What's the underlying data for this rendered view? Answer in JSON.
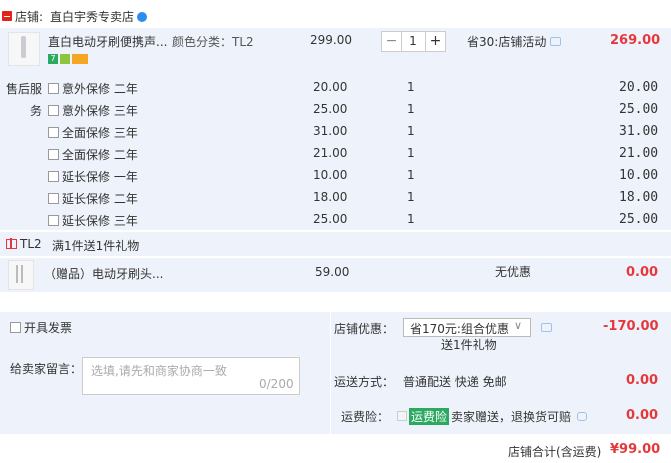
{
  "shop": {
    "label": "店铺:",
    "name": "直白宇秀专卖店"
  },
  "product": {
    "title": "直白电动牙刷便携声...",
    "variant": "颜色分类：TL2",
    "price": "299.00",
    "quantity": "1",
    "promo": "省30:店铺活动",
    "subtotal": "269.00",
    "minus": "−",
    "plus": "+"
  },
  "service": {
    "label_line1": "售后服",
    "label_line2": "务",
    "items": [
      {
        "name": "意外保修 二年",
        "price": "20.00",
        "qty": "1",
        "subtotal": "20.00"
      },
      {
        "name": "意外保修 三年",
        "price": "25.00",
        "qty": "1",
        "subtotal": "25.00"
      },
      {
        "name": "全面保修 三年",
        "price": "31.00",
        "qty": "1",
        "subtotal": "31.00"
      },
      {
        "name": "全面保修 二年",
        "price": "21.00",
        "qty": "1",
        "subtotal": "21.00"
      },
      {
        "name": "延长保修 一年",
        "price": "10.00",
        "qty": "1",
        "subtotal": "10.00"
      },
      {
        "name": "延长保修 二年",
        "price": "18.00",
        "qty": "1",
        "subtotal": "18.00"
      },
      {
        "name": "延长保修 三年",
        "price": "25.00",
        "qty": "1",
        "subtotal": "25.00"
      }
    ]
  },
  "gift_group": {
    "tag": "TL2",
    "rule": "满1件送1件礼物"
  },
  "gift": {
    "title": "（赠品）电动牙刷头...",
    "price": "59.00",
    "discount": "无优惠",
    "subtotal": "0.00"
  },
  "invoice": {
    "label": "开具发票"
  },
  "message": {
    "label": "给卖家留言：",
    "placeholder": "选填,请先和商家协商一致",
    "counter": "0/200"
  },
  "shop_discount": {
    "label": "店铺优惠：",
    "selected": "省170元:组合优惠",
    "note": "送1件礼物",
    "amount": "-170.00"
  },
  "shipping": {
    "label": "运送方式：",
    "value": "普通配送 快递 免邮",
    "amount": "0.00"
  },
  "insurance": {
    "label": "运费险：",
    "badge": "运费险",
    "text": "卖家赠送，退换货可赔",
    "amount": "0.00"
  },
  "total": {
    "label": "店铺合计(含运费)",
    "amount": "¥99.00"
  },
  "colors": {
    "accent": "#e4393c",
    "panel": "#eef3fb",
    "badge_green": "#2ca961"
  }
}
